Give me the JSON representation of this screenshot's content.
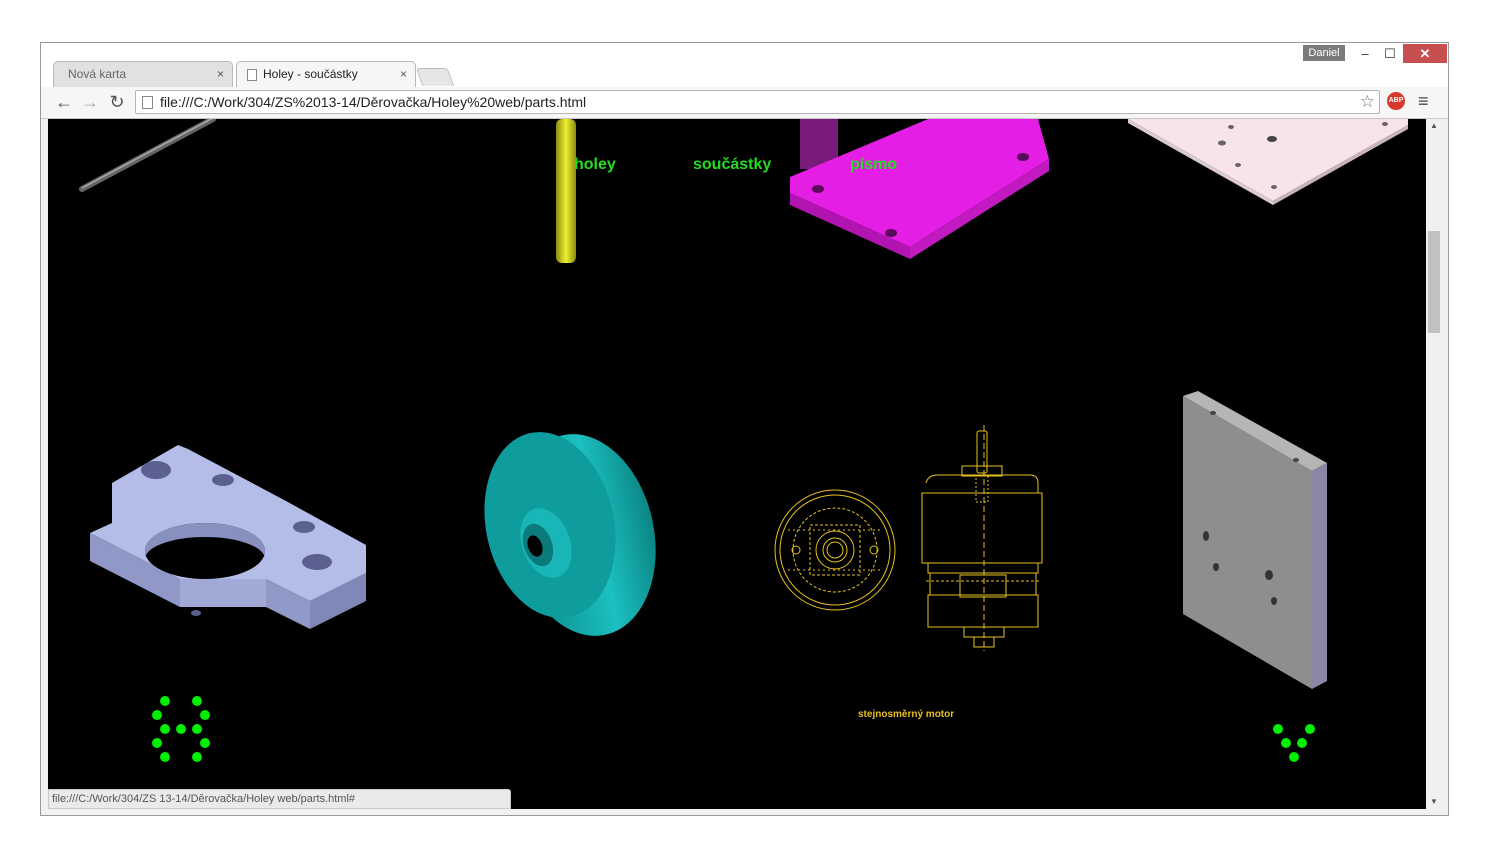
{
  "window": {
    "user": "Daniel",
    "minimize": "‒",
    "maximize": "☐",
    "close": "✕"
  },
  "tabs": [
    {
      "label": "Nová karta",
      "active": false,
      "close": "×"
    },
    {
      "label": "Holey - součástky",
      "active": true,
      "close": "×"
    }
  ],
  "toolbar": {
    "back": "←",
    "forward": "→",
    "reload": "↻",
    "url": "file:///C:/Work/304/ZS%2013-14/Děrovačka/Holey%20web/parts.html",
    "star": "☆",
    "abp": "ABP",
    "menu": "≡"
  },
  "page": {
    "nav": [
      "holey",
      "součástky",
      "písmo"
    ],
    "caption": "stejnosměrný motor",
    "colors": {
      "background": "#000000",
      "nav": "#22dd22",
      "motor": "#e6c021",
      "bracket": "#b3bde8",
      "pulley": "#14a3a3",
      "magenta": "#e41ee4",
      "slab": "#8e8e8e"
    }
  },
  "status": {
    "text": "file:///C:/Work/304/ZS 13-14/Děrovačka/Holey web/parts.html#"
  },
  "scrollbar": {
    "up": "▲",
    "down": "▼"
  }
}
